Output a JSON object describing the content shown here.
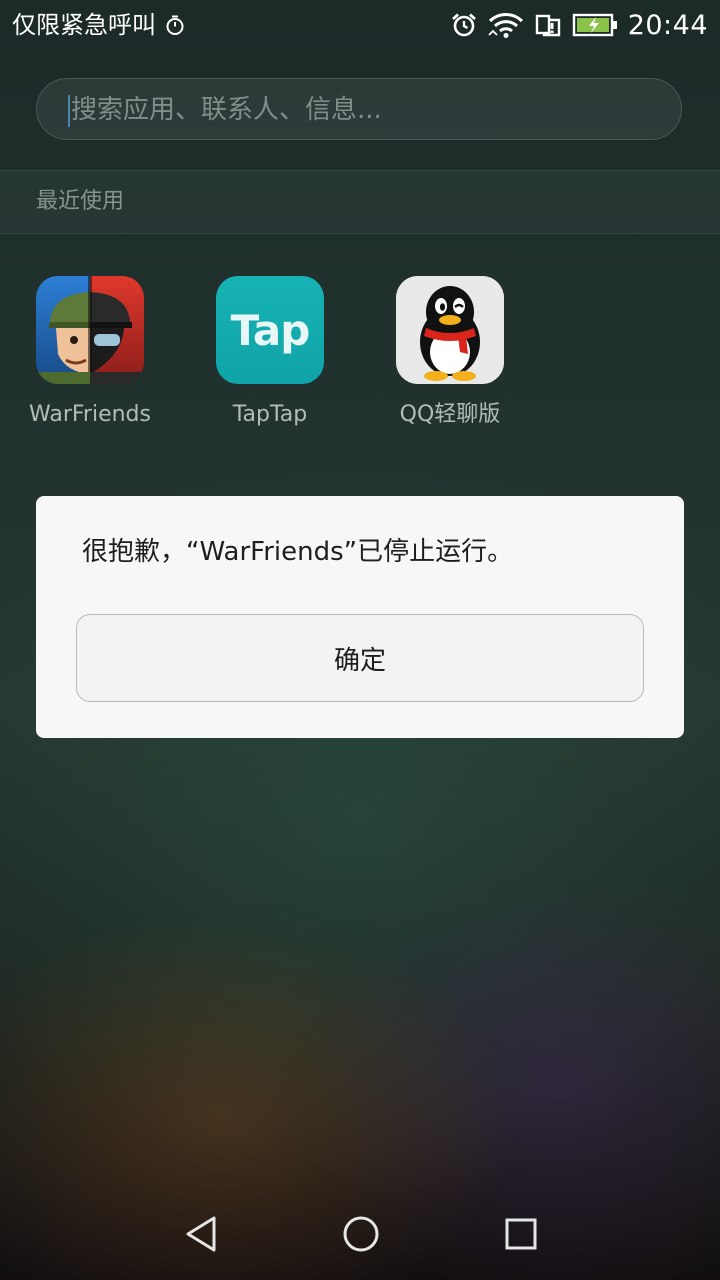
{
  "status_bar": {
    "carrier_text": "仅限紧急呼叫",
    "time": "20:44",
    "icons": [
      "stopwatch-icon",
      "alarm-icon",
      "wifi-icon",
      "sim-alert-icon",
      "battery-charging-icon"
    ]
  },
  "search": {
    "placeholder": "搜索应用、联系人、信息..."
  },
  "recent": {
    "title": "最近使用",
    "apps": [
      {
        "label": "WarFriends",
        "icon": "warfriends-app-icon"
      },
      {
        "label": "TapTap",
        "icon": "taptap-app-icon",
        "icon_text": "Tap"
      },
      {
        "label": "QQ轻聊版",
        "icon": "qq-app-icon"
      }
    ]
  },
  "dialog": {
    "message": "很抱歉，“WarFriends”已停止运行。",
    "ok_label": "确定"
  },
  "nav_bar": {
    "icons": [
      "back-icon",
      "home-icon",
      "recents-icon"
    ]
  },
  "colors": {
    "taptap": "#15adb0",
    "dialog_bg": "#f7f7f7",
    "battery_fill": "#8bc34a"
  }
}
